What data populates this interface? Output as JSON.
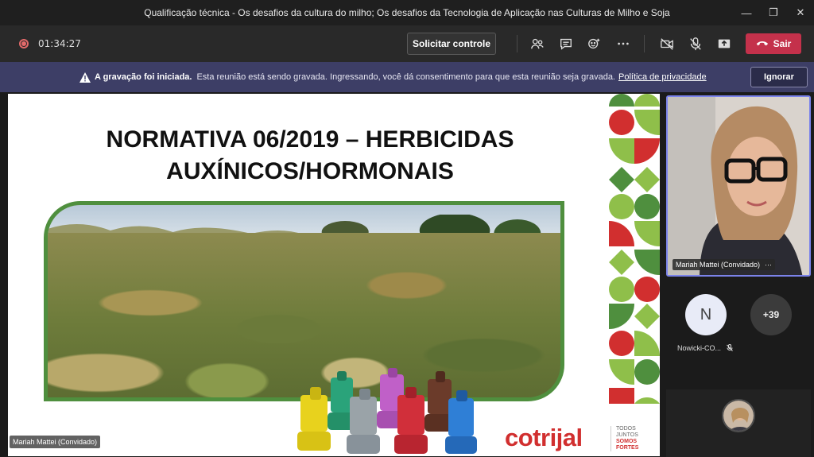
{
  "window": {
    "title": "Qualificação técnica - Os desafios da cultura do milho; Os desafios da Tecnologia de Aplicação nas Culturas de Milho e Soja",
    "controls": [
      "minimize-icon",
      "restore-icon",
      "close-icon"
    ]
  },
  "toolbar": {
    "timer": "01:34:27",
    "request_control_label": "Solicitar controle",
    "leave_label": "Sair",
    "icons": [
      "participants-icon",
      "chat-icon",
      "reactions-icon",
      "more-icon",
      "camera-off-icon",
      "mic-off-icon",
      "share-icon",
      "phone-icon"
    ]
  },
  "banner": {
    "title": "A gravação foi iniciada.",
    "message": "Esta reunião está sendo gravada. Ingressando, você dá consentimento para que esta reunião seja gravada.",
    "link": "Política de privacidade",
    "ignore_label": "Ignorar"
  },
  "slide": {
    "title_line1": "NORMATIVA 06/2019 – HERBICIDAS",
    "title_line2": "AUXÍNICOS/HORMONAIS",
    "logo": "cotrijal",
    "tagline": [
      "TODOS",
      "JUNTOS",
      "SOMOS",
      "FORTES"
    ],
    "presenter_tag": "Mariah Mattei (Convidado)",
    "colors": {
      "green": "#4f8f3e",
      "red": "#d12f2f",
      "lightgreen": "#8fbf4a"
    }
  },
  "participants": {
    "camera_name": "Mariah Mattei (Convidado)",
    "camera_more": "···",
    "avatar_initial": "N",
    "avatar_name": "Nowicki-CO...",
    "overflow_count": "+39"
  }
}
